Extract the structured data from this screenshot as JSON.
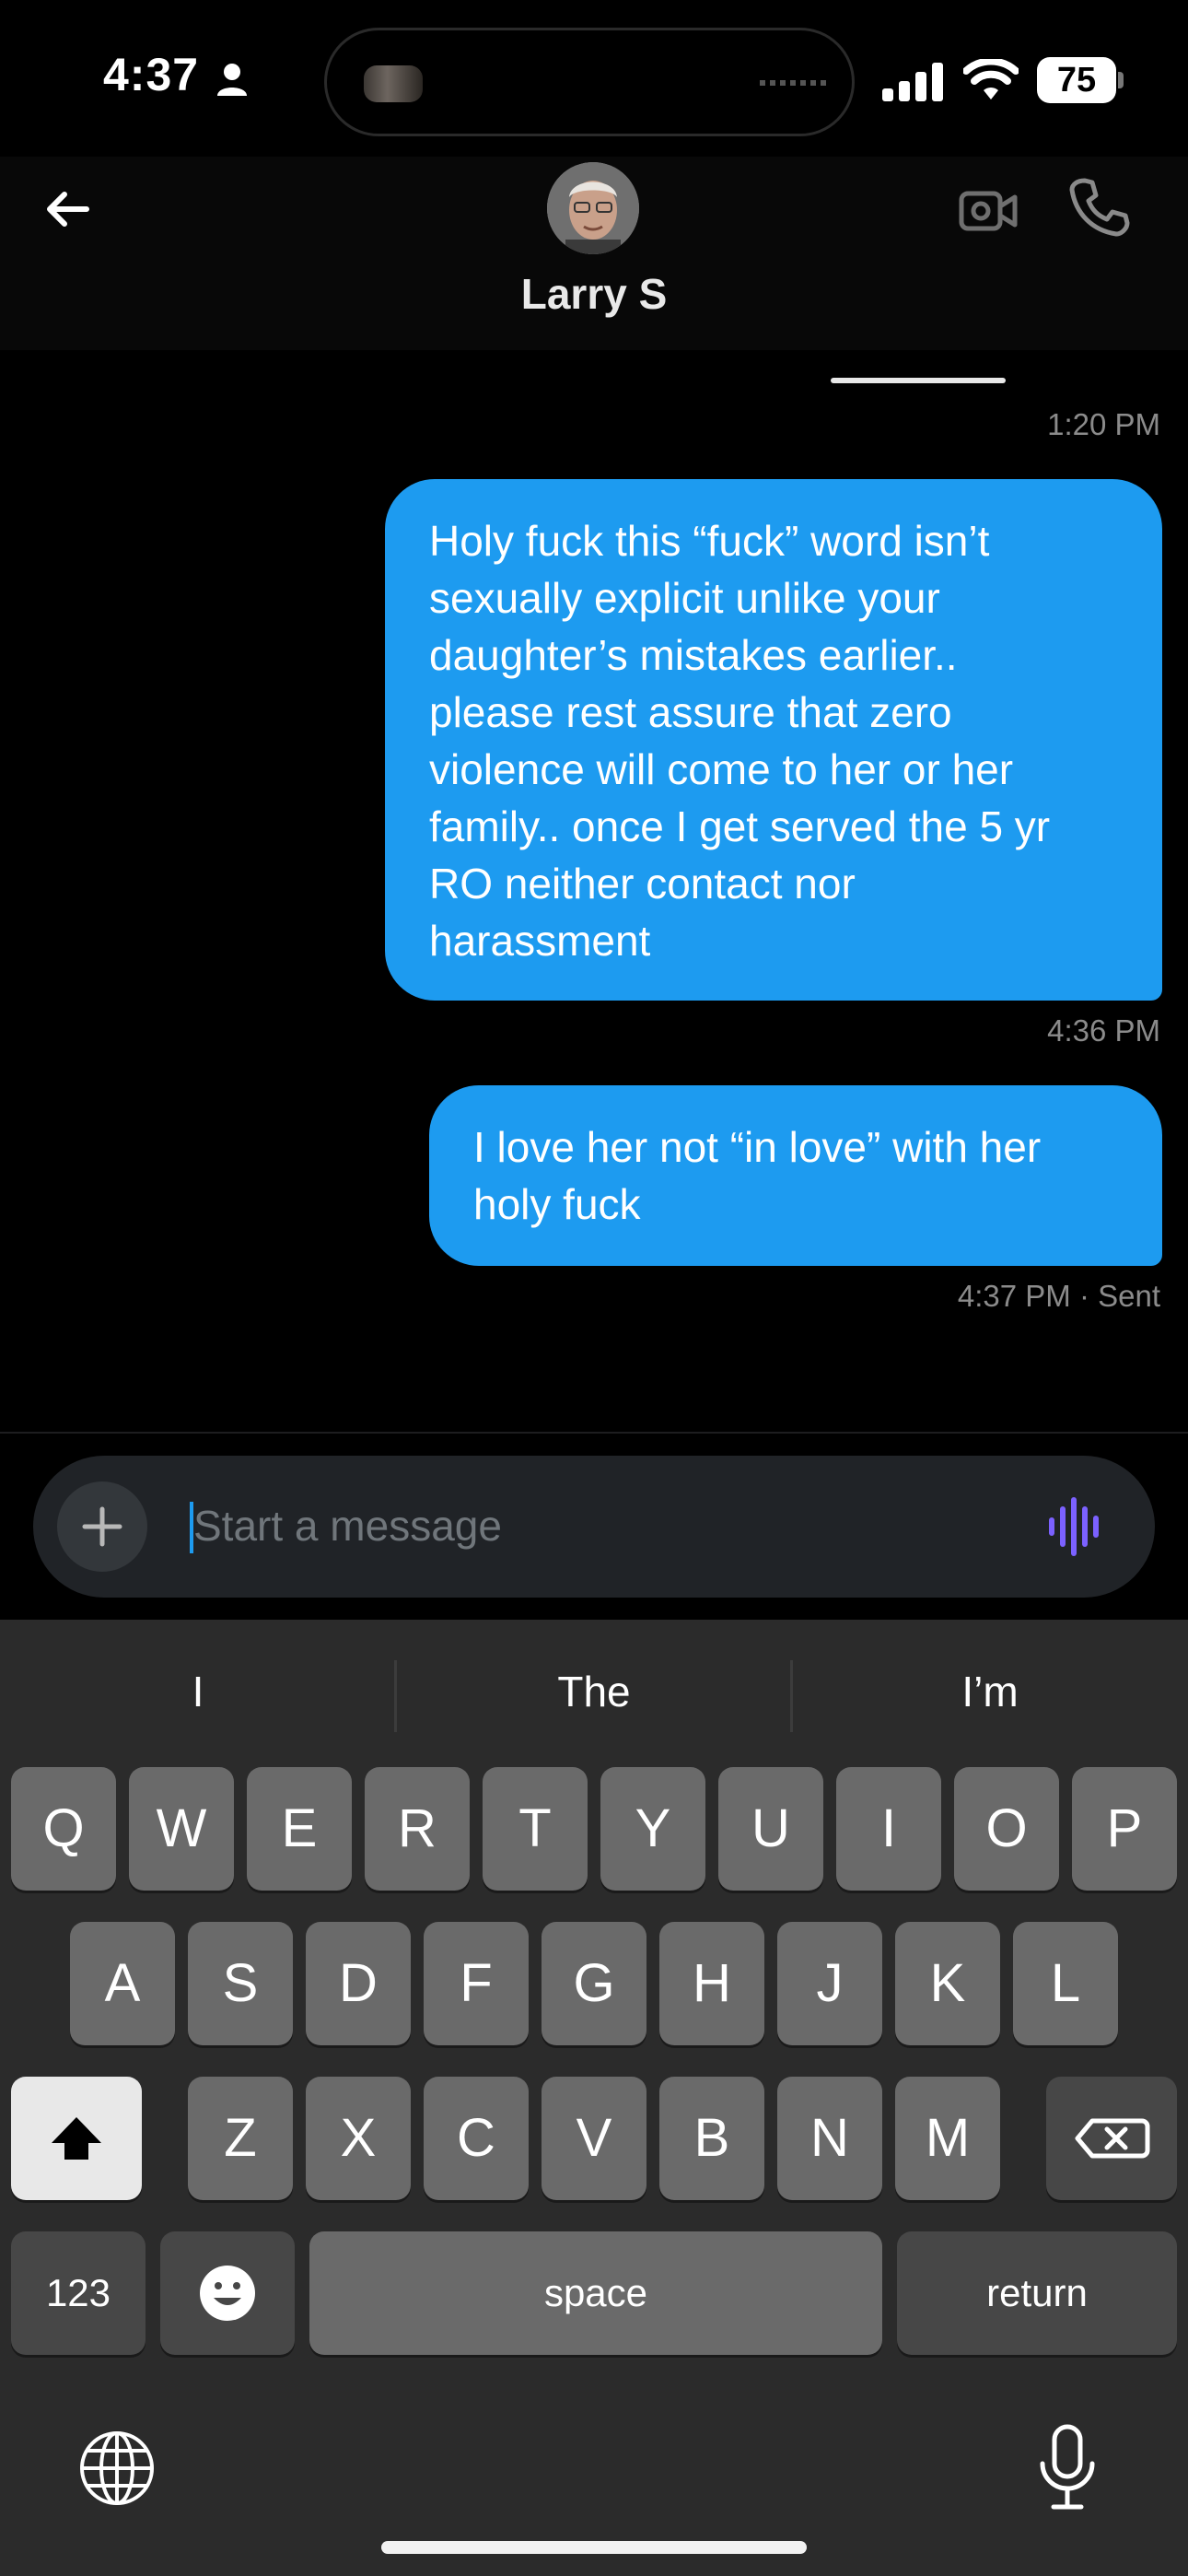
{
  "status_bar": {
    "time": "4:37",
    "battery_level": "75",
    "icons": [
      "person-icon",
      "signal-icon",
      "wifi-icon",
      "battery-icon"
    ]
  },
  "header": {
    "contact_name": "Larry S",
    "back_icon": "arrow-left-icon",
    "video_icon": "video-camera-icon",
    "call_icon": "phone-icon"
  },
  "messages": {
    "ts1": "1:20 PM",
    "bubble1": "Holy fuck this “fuck” word isn’t\nsexually explicit unlike your\ndaughter’s mistakes earlier..\nplease rest assure that zero\nviolence will come to her or her\nfamily.. once I get served the 5 yr\nRO neither contact nor\nharassment",
    "ts2": "4:36 PM",
    "bubble2": "I love her not “in love” with her\nholy fuck",
    "ts3": "4:37 PM · Sent"
  },
  "composer": {
    "placeholder": "Start a message",
    "value": "",
    "plus_icon": "plus-icon",
    "voice_icon": "voice-wave-icon"
  },
  "keyboard": {
    "suggestions": [
      "I",
      "The",
      "I’m"
    ],
    "row1": [
      "Q",
      "W",
      "E",
      "R",
      "T",
      "Y",
      "U",
      "I",
      "O",
      "P"
    ],
    "row2": [
      "A",
      "S",
      "D",
      "F",
      "G",
      "H",
      "J",
      "K",
      "L"
    ],
    "row3": [
      "Z",
      "X",
      "C",
      "V",
      "B",
      "N",
      "M"
    ],
    "numbers_label": "123",
    "space_label": "space",
    "return_label": "return"
  },
  "colors": {
    "accent": "#1d9bf0",
    "background": "#000000",
    "voice_accent": "#7b61ff"
  }
}
